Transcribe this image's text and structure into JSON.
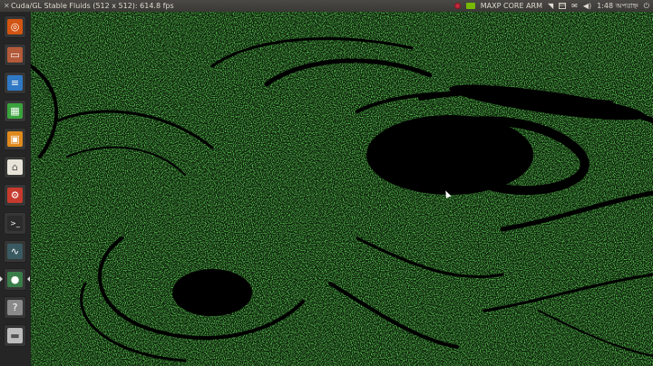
{
  "window": {
    "title": "Cuda/GL Stable Fluids (512 x 512): 614.8 fps"
  },
  "panel": {
    "network_label": "MAXP CORE ARM",
    "clock": "1:48",
    "clock_suffix": "অপরাহ্ন",
    "keyboard": "En",
    "icons": [
      "record-indicator-icon",
      "nvidia-icon",
      "wifi-icon",
      "keyboard-layout-icon",
      "mail-icon",
      "volume-icon",
      "power-icon"
    ]
  },
  "launcher": {
    "items": [
      {
        "name": "dash-home",
        "icon": "ubuntu-logo-icon",
        "color": "#d35513"
      },
      {
        "name": "files",
        "icon": "file-cabinet-icon",
        "color": "#b35a3a"
      },
      {
        "name": "writer",
        "icon": "document-icon",
        "color": "#2f78c4"
      },
      {
        "name": "calc",
        "icon": "spreadsheet-icon",
        "color": "#3aa33d"
      },
      {
        "name": "impress",
        "icon": "presentation-icon",
        "color": "#e08a1e"
      },
      {
        "name": "software-center",
        "icon": "shopping-bag-icon",
        "color": "#e8e3d8"
      },
      {
        "name": "system-settings",
        "icon": "wrench-gear-icon",
        "color": "#c63a2e"
      },
      {
        "name": "terminal",
        "icon": "terminal-icon",
        "color": "#2b2b2b"
      },
      {
        "name": "system-monitor",
        "icon": "monitor-graph-icon",
        "color": "#3a5a62"
      },
      {
        "name": "fluid-app",
        "icon": "globe-icon",
        "color": "#3b7d4a"
      },
      {
        "name": "unknown-app",
        "icon": "question-icon",
        "color": "#8a8a8a"
      },
      {
        "name": "drive",
        "icon": "drive-icon",
        "color": "#bdbdbd"
      }
    ],
    "active_index": 9
  },
  "colors": {
    "fluid_green": "#2fae2b",
    "fluid_dark": "#000000",
    "panel_bg": "#3c3b37"
  }
}
